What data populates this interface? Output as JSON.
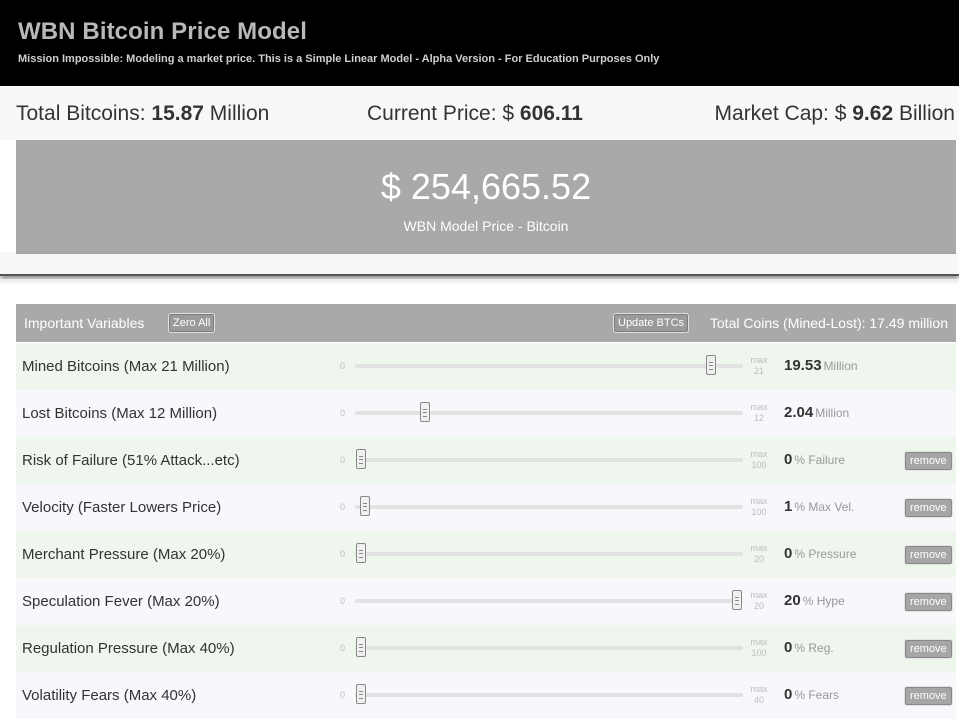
{
  "header": {
    "title": "WBN Bitcoin Price Model",
    "subtitle": "Mission Impossible: Modeling a market price. This is a Simple Linear Model - Alpha Version - For Education Purposes Only"
  },
  "stats": {
    "total_label": "Total Bitcoins: ",
    "total_value": "15.87",
    "total_unit": " Million",
    "price_label": "Current Price: $ ",
    "price_value": "606.11",
    "cap_label": "Market Cap: $ ",
    "cap_value": "9.62",
    "cap_unit": " Billion"
  },
  "model": {
    "price": "$ 254,665.52",
    "label": "WBN Model Price - Bitcoin"
  },
  "variables": {
    "title": "Important Variables",
    "zero_all_label": "Zero All",
    "update_label": "Update BTCs",
    "total_coins": "Total Coins (Mined-Lost): 17.49 million",
    "remove_label": "remove",
    "rows": [
      {
        "label": "Mined Bitcoins (Max 21 Million)",
        "min": "0",
        "max_word": "max",
        "max": "21",
        "value": "19.53",
        "unit": "Million",
        "level": 0.93,
        "removable": false
      },
      {
        "label": "Lost Bitcoins (Max 12 Million)",
        "min": "0",
        "max_word": "max",
        "max": "12",
        "value": "2.04",
        "unit": "Million",
        "level": 0.17,
        "removable": false
      },
      {
        "label": "Risk of Failure (51% Attack...etc)",
        "min": "0",
        "max_word": "max",
        "max": "100",
        "value": "0",
        "unit": "% Failure",
        "level": 0.0,
        "removable": true
      },
      {
        "label": "Velocity (Faster Lowers Price)",
        "min": "0",
        "max_word": "max",
        "max": "100",
        "value": "1",
        "unit": "% Max Vel.",
        "level": 0.01,
        "removable": true
      },
      {
        "label": "Merchant Pressure (Max 20%)",
        "min": "0",
        "max_word": "max",
        "max": "20",
        "value": "0",
        "unit": "% Pressure",
        "level": 0.0,
        "removable": true
      },
      {
        "label": "Speculation Fever (Max 20%)",
        "min": "0",
        "max_word": "max",
        "max": "20",
        "value": "20",
        "unit": "% Hype",
        "level": 1.0,
        "removable": true
      },
      {
        "label": "Regulation Pressure (Max 40%)",
        "min": "0",
        "max_word": "max",
        "max": "100",
        "value": "0",
        "unit": "% Reg.",
        "level": 0.0,
        "removable": true
      },
      {
        "label": "Volatility Fears (Max 40%)",
        "min": "0",
        "max_word": "max",
        "max": "40",
        "value": "0",
        "unit": "% Fears",
        "level": 0.0,
        "removable": true
      }
    ]
  }
}
